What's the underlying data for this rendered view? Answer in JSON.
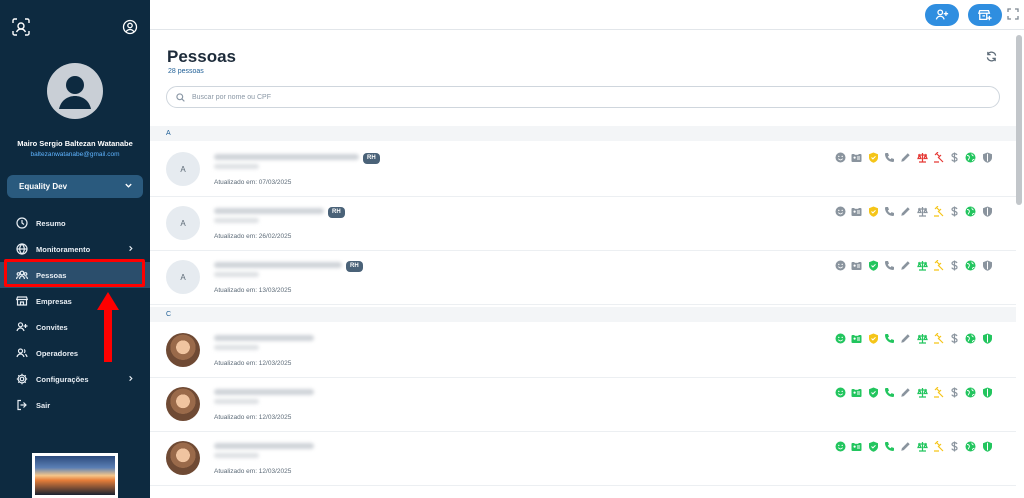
{
  "sidebar": {
    "user_name": "Mairo Sergio Baltezan Watanabe",
    "user_email": "baltezanwatanabe@gmail.com",
    "org": "Equality Dev",
    "items": [
      {
        "label": "Resumo",
        "icon": "clock-icon",
        "chevron": false
      },
      {
        "label": "Monitoramento",
        "icon": "globe-icon",
        "chevron": true
      },
      {
        "label": "Pessoas",
        "icon": "people-icon",
        "chevron": false,
        "active": true
      },
      {
        "label": "Empresas",
        "icon": "store-icon",
        "chevron": false
      },
      {
        "label": "Convites",
        "icon": "user-plus-icon",
        "chevron": false
      },
      {
        "label": "Operadores",
        "icon": "operators-icon",
        "chevron": false
      },
      {
        "label": "Configurações",
        "icon": "gear-icon",
        "chevron": true
      },
      {
        "label": "Sair",
        "icon": "logout-icon",
        "chevron": false
      }
    ]
  },
  "main": {
    "title": "Pessoas",
    "count": "28 pessoas",
    "search_placeholder": "Buscar por nome ou CPF",
    "sections": [
      {
        "letter": "A",
        "rows": [
          {
            "initial": "A",
            "updated": "Atualizado em: 07/03/2025",
            "rh": "RH",
            "status": [
              "g",
              "g",
              "y",
              "g",
              "g",
              "r",
              "r",
              "g",
              "gn",
              "g"
            ]
          },
          {
            "initial": "A",
            "updated": "Atualizado em: 26/02/2025",
            "rh": "RH",
            "status": [
              "g",
              "g",
              "y",
              "g",
              "g",
              "g",
              "y",
              "g",
              "gn",
              "g"
            ]
          },
          {
            "initial": "A",
            "updated": "Atualizado em: 13/03/2025",
            "rh": "RH",
            "status": [
              "g",
              "g",
              "gn",
              "g",
              "g",
              "gn",
              "y",
              "g",
              "gn",
              "g"
            ]
          }
        ]
      },
      {
        "letter": "C",
        "rows": [
          {
            "initial": "",
            "updated": "Atualizado em: 12/03/2025",
            "rh": "",
            "status": [
              "gn",
              "gn",
              "y",
              "gn",
              "g",
              "gn",
              "y",
              "g",
              "gn",
              "gn"
            ]
          },
          {
            "initial": "",
            "updated": "Atualizado em: 12/03/2025",
            "rh": "",
            "status": [
              "gn",
              "gn",
              "gn",
              "gn",
              "g",
              "gn",
              "y",
              "g",
              "gn",
              "gn"
            ]
          },
          {
            "initial": "",
            "updated": "Atualizado em: 12/03/2025",
            "rh": "",
            "status": [
              "gn",
              "gn",
              "gn",
              "gn",
              "g",
              "gn",
              "y",
              "g",
              "gn",
              "gn"
            ]
          }
        ]
      }
    ]
  },
  "colors": {
    "sidebar_bg": "#0d2a40",
    "accent": "#2f8ee0",
    "green": "#22c55e",
    "yellow": "#f5c518",
    "red": "#e53935",
    "gray": "#8a949e"
  }
}
